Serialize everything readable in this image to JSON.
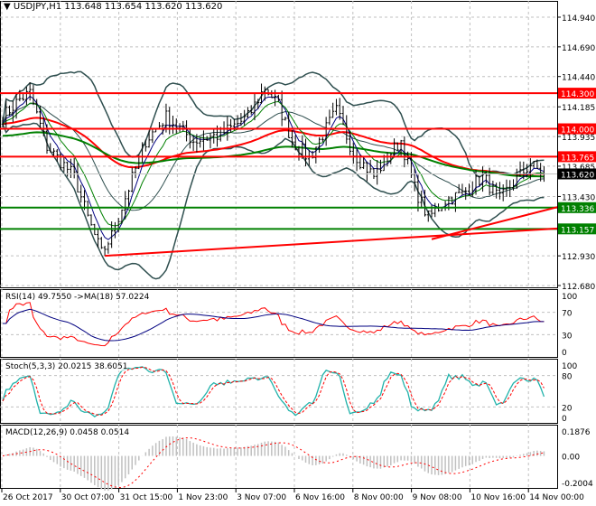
{
  "header": {
    "symbol": "USDJPY,H1",
    "ohlc": "113.648 113.654 113.620 113.620"
  },
  "chart_data": {
    "type": "line",
    "title": "USDJPY,H1",
    "main": {
      "ylim": [
        112.68,
        114.94
      ],
      "y_ticks": [
        "114.940",
        "114.690",
        "114.440",
        "114.185",
        "113.935",
        "113.685",
        "113.430",
        "112.930",
        "112.680"
      ],
      "price_path_waypoints": [
        [
          0,
          114.1
        ],
        [
          5,
          114.25
        ],
        [
          8,
          114.3
        ],
        [
          13,
          113.85
        ],
        [
          21,
          113.6
        ],
        [
          25,
          113.25
        ],
        [
          29,
          112.95
        ],
        [
          32,
          113.1
        ],
        [
          37,
          113.5
        ],
        [
          42,
          113.9
        ],
        [
          48,
          114.1
        ],
        [
          56,
          113.9
        ],
        [
          64,
          113.95
        ],
        [
          72,
          114.1
        ],
        [
          77,
          114.35
        ],
        [
          81,
          114.2
        ],
        [
          85,
          113.9
        ],
        [
          90,
          113.75
        ],
        [
          95,
          114.0
        ],
        [
          98,
          114.15
        ],
        [
          103,
          113.8
        ],
        [
          109,
          113.6
        ],
        [
          114,
          113.8
        ],
        [
          117,
          113.9
        ],
        [
          121,
          113.5
        ],
        [
          125,
          113.25
        ],
        [
          130,
          113.4
        ],
        [
          135,
          113.45
        ],
        [
          141,
          113.6
        ],
        [
          146,
          113.4
        ],
        [
          150,
          113.55
        ],
        [
          155,
          113.7
        ],
        [
          159,
          113.62
        ]
      ],
      "levels": [
        {
          "label": "114.300",
          "value": 114.3,
          "color": "#ff0000"
        },
        {
          "label": "114.000",
          "value": 114.0,
          "color": "#ff0000"
        },
        {
          "label": "113.765",
          "value": 113.765,
          "color": "#ff0000"
        },
        {
          "label": "113.336",
          "value": 113.336,
          "color": "#008000"
        },
        {
          "label": "113.157",
          "value": 113.157,
          "color": "#008000"
        }
      ],
      "trendlines": [
        [
          [
            30,
            112.93
          ],
          [
            163,
            113.16
          ]
        ],
        [
          [
            126,
            113.07
          ],
          [
            163,
            113.34
          ]
        ]
      ],
      "current_price": "113.620"
    },
    "rsi": {
      "label": "RSI(14) 49.7550  ->MA(18) 57.0224",
      "ylim": [
        0,
        100
      ],
      "ticks": [
        "100",
        "70",
        "30",
        "0"
      ]
    },
    "stoch": {
      "label": "Stoch(5,3,3) 20.0215 38.6051",
      "ylim": [
        0,
        100
      ],
      "ticks": [
        "100",
        "80",
        "20",
        "0"
      ]
    },
    "macd": {
      "label": "MACD(12,26,9) 0.0458 0.0514",
      "ylim": [
        -0.2004,
        0.1876
      ],
      "ticks": [
        "0.1876",
        "0.00",
        "-0.2004"
      ]
    },
    "x_labels": [
      "26 Oct 2017",
      "30 Oct 07:00",
      "31 Oct 15:00",
      "1 Nov 23:00",
      "3 Nov 07:00",
      "6 Nov 16:00",
      "8 Nov 00:00",
      "9 Nov 08:00",
      "10 Nov 16:00",
      "14 Nov 00:00"
    ],
    "colors": {
      "bb": "#2f4f4f",
      "ma_slow": "#ff0000",
      "ma_long": "#008000",
      "rsi": "#ff0000",
      "rsi_ma": "#000080",
      "stoch": "#20b2aa",
      "signal": "#ff0000",
      "hist": "#c0c0c0"
    }
  }
}
